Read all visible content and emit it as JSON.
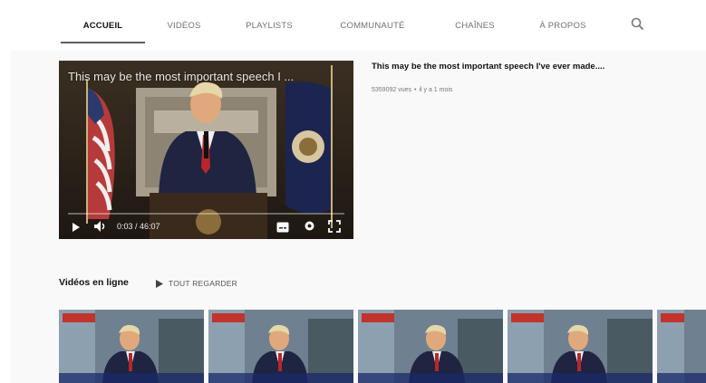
{
  "tabs": [
    {
      "label": "ACCUEIL",
      "active": true
    },
    {
      "label": "VIDÉOS",
      "active": false
    },
    {
      "label": "PLAYLISTS",
      "active": false
    },
    {
      "label": "COMMUNAUTÉ",
      "active": false
    },
    {
      "label": "CHAÎNES",
      "active": false
    },
    {
      "label": "À PROPOS",
      "active": false
    }
  ],
  "search_icon": "search-icon",
  "featured": {
    "overlay_title": "This may be the most important speech I ...",
    "title": "This may be the most important speech I've ever made....",
    "views": "5359092 vues",
    "age": "il y a 1 mois",
    "time": "0:03 / 46:07",
    "progress": 0.001
  },
  "shelf": {
    "title": "Vidéos en ligne",
    "play_all": "TOUT REGARDER"
  },
  "colors": {
    "active_tab_underline": "#5f5f5f",
    "page_background": "#f9f9f9"
  }
}
